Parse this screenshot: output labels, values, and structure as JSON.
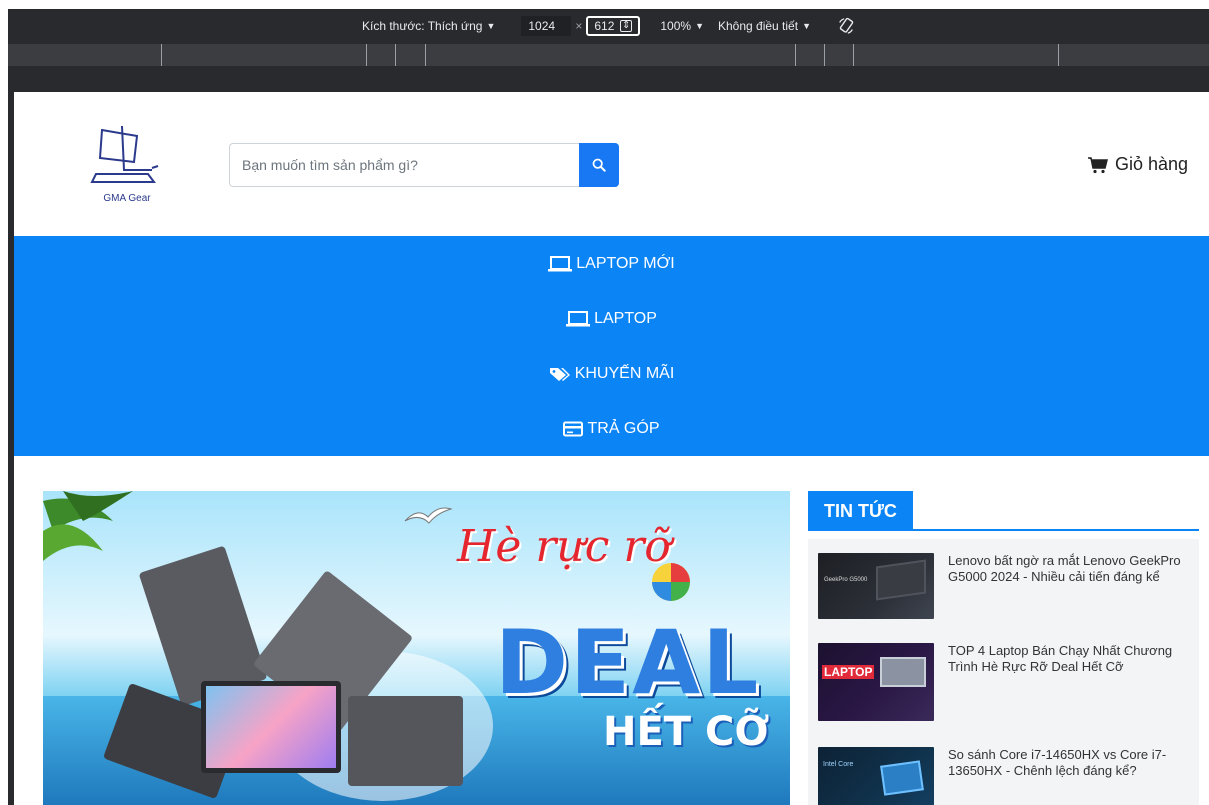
{
  "devtools": {
    "dimensions_label": "Kích thước: Thích ứng",
    "width": "1024",
    "x": "×",
    "height": "612",
    "zoom": "100%",
    "throttle": "Không điều tiết"
  },
  "header": {
    "logo_text": "GMA Gear",
    "search_placeholder": "Bạn muốn tìm sản phẩm gì?",
    "cart_label": "Giỏ hàng"
  },
  "nav": {
    "items": [
      {
        "label": "LAPTOP MỚI",
        "icon": "laptop-icon"
      },
      {
        "label": "LAPTOP",
        "icon": "laptop-icon"
      },
      {
        "label": "KHUYẾN MÃI",
        "icon": "tags-icon"
      },
      {
        "label": "TRẢ GÓP",
        "icon": "credit-card-icon"
      }
    ]
  },
  "banner": {
    "title": "Hè rực rỡ",
    "deal": "DEAL",
    "subtitle": "HẾT CỠ"
  },
  "news": {
    "title": "TIN TỨC",
    "items": [
      {
        "text": "Lenovo bất ngờ ra mắt Lenovo GeekPro G5000 2024 - Nhiều cải tiến đáng kể",
        "thumb_label": "GeekPro G5000"
      },
      {
        "text": "TOP 4 Laptop Bán Chạy Nhất Chương Trình Hè Rực Rỡ Deal Hết Cỡ",
        "thumb_label": "LAPTOP"
      },
      {
        "text": "So sánh Core i7-14650HX vs Core i7-13650HX - Chênh lệch đáng kể?",
        "thumb_label": "Intel Core"
      }
    ]
  },
  "colors": {
    "brand_blue": "#0b84f5",
    "search_button": "#1877f2",
    "devtools_bg": "#292a2d"
  }
}
